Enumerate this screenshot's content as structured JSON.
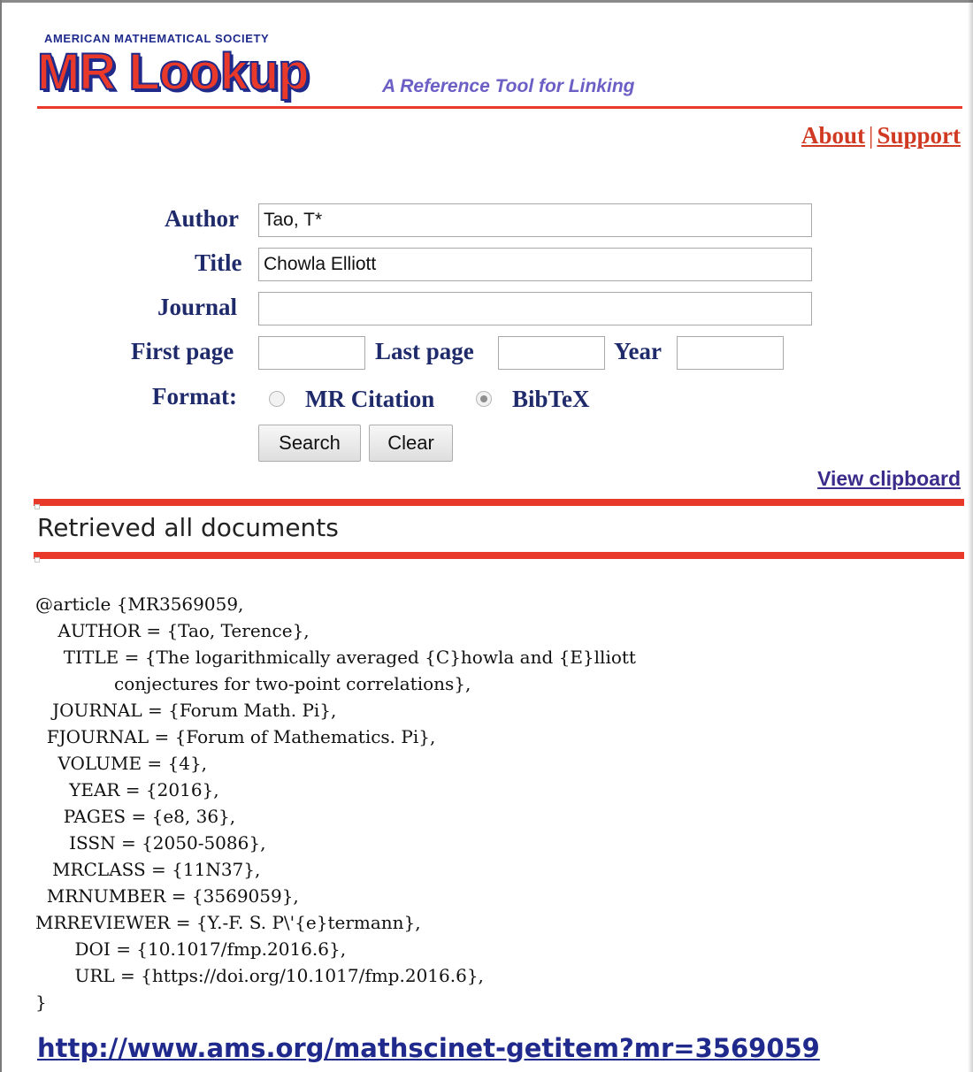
{
  "header": {
    "society": "AMERICAN MATHEMATICAL SOCIETY",
    "logo": "MR Lookup",
    "tagline": "A Reference Tool for Linking",
    "links": {
      "about": "About",
      "separator": "|",
      "support": "Support"
    }
  },
  "form": {
    "author": {
      "label": "Author",
      "value": "Tao, T*"
    },
    "title": {
      "label": "Title",
      "value": "Chowla Elliott"
    },
    "journal": {
      "label": "Journal",
      "value": ""
    },
    "first_page": {
      "label": "First page",
      "value": ""
    },
    "last_page": {
      "label": "Last page",
      "value": ""
    },
    "year": {
      "label": "Year",
      "value": ""
    },
    "format": {
      "label": "Format:",
      "options": [
        "MR Citation",
        "BibTeX"
      ],
      "selected": "BibTeX"
    },
    "buttons": {
      "search": "Search",
      "clear": "Clear"
    }
  },
  "clipboard_link": "View clipboard",
  "status": "Retrieved all documents",
  "bibtex": "@article {MR3569059,\n    AUTHOR = {Tao, Terence},\n     TITLE = {The logarithmically averaged {C}howla and {E}lliott\n              conjectures for two-point correlations},\n   JOURNAL = {Forum Math. Pi},\n  FJOURNAL = {Forum of Mathematics. Pi},\n    VOLUME = {4},\n      YEAR = {2016},\n     PAGES = {e8, 36},\n      ISSN = {2050-5086},\n   MRCLASS = {11N37},\n  MRNUMBER = {3569059},\nMRREVIEWER = {Y.-F. S. P\\'{e}termann},\n       DOI = {10.1017/fmp.2016.6},\n       URL = {https://doi.org/10.1017/fmp.2016.6},\n}",
  "mathscinet_link": "http://www.ams.org/mathscinet-getitem?mr=3569059",
  "colors": {
    "brand_red": "#e8392a",
    "brand_blue": "#1f2a8a",
    "label_navy": "#1f2a6b"
  }
}
